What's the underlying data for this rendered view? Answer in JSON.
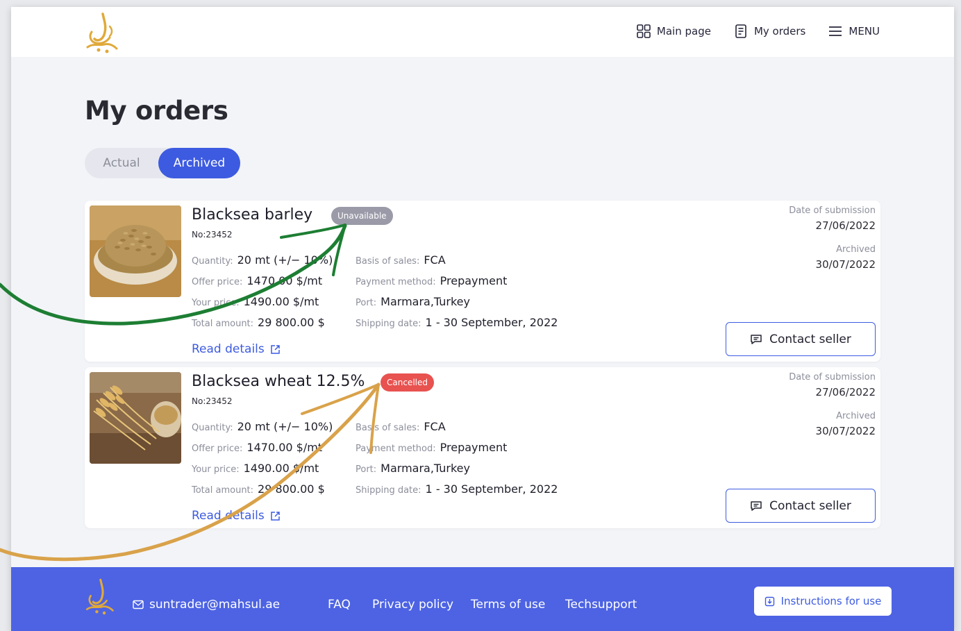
{
  "nav": {
    "main_page": "Main page",
    "my_orders": "My orders",
    "menu": "MENU"
  },
  "page": {
    "title": "My orders"
  },
  "tabs": {
    "actual": "Actual",
    "archived": "Archived",
    "active": "Archived"
  },
  "labels": {
    "quantity": "Quantity:",
    "offer_price": "Offer price:",
    "your_price": "Your price:",
    "total_amount": "Total amount:",
    "basis": "Basis of sales:",
    "payment": "Payment method:",
    "port": "Port:",
    "shipping": "Shipping date:",
    "date_submission": "Date of submission",
    "archived": "Archived",
    "read_details": "Read details",
    "contact_seller": "Contact seller"
  },
  "orders": [
    {
      "name": "Blacksea barley",
      "number": "No:23452",
      "status": "Unavailable",
      "status_color": "#9a9aa8",
      "quantity": "20 mt (+/− 10%)",
      "offer_price": "1470.00 $/mt",
      "your_price": "1490.00 $/mt",
      "total_amount": "29 800.00 $",
      "basis": "FCA",
      "payment": "Prepayment",
      "port": "Marmara,Turkey",
      "shipping": "1 - 30 September, 2022",
      "date_submission": "27/06/2022",
      "archived_date": "30/07/2022",
      "image": "barley-bowl-photo"
    },
    {
      "name": "Blacksea wheat 12.5%",
      "number": "No:23452",
      "status": "Cancelled",
      "status_color": "#e8524f",
      "quantity": "20 mt (+/− 10%)",
      "offer_price": "1470.00 $/mt",
      "your_price": "1490.00 $/mt",
      "total_amount": "29 800.00 $",
      "basis": "FCA",
      "payment": "Prepayment",
      "port": "Marmara,Turkey",
      "shipping": "1 - 30 September, 2022",
      "date_submission": "27/06/2022",
      "archived_date": "30/07/2022",
      "image": "wheat-ears-photo"
    }
  ],
  "footer": {
    "email": "suntrader@mahsul.ae",
    "faq": "FAQ",
    "privacy": "Privacy policy",
    "terms": "Terms of use",
    "techsupport": "Techsupport",
    "instructions": "Instructions for use"
  },
  "colors": {
    "accent": "#3d5be0",
    "footer_bg": "#4d63e3",
    "logo_gold": "#e0a93a",
    "arrow_green": "#1d7e33",
    "arrow_gold": "#d9a24a"
  },
  "icons": {
    "main_page": "grid-icon",
    "my_orders": "document-icon",
    "menu": "hamburger-icon",
    "read_details": "external-link-icon",
    "contact_seller": "chat-icon",
    "email": "mail-icon",
    "instructions": "download-icon"
  }
}
